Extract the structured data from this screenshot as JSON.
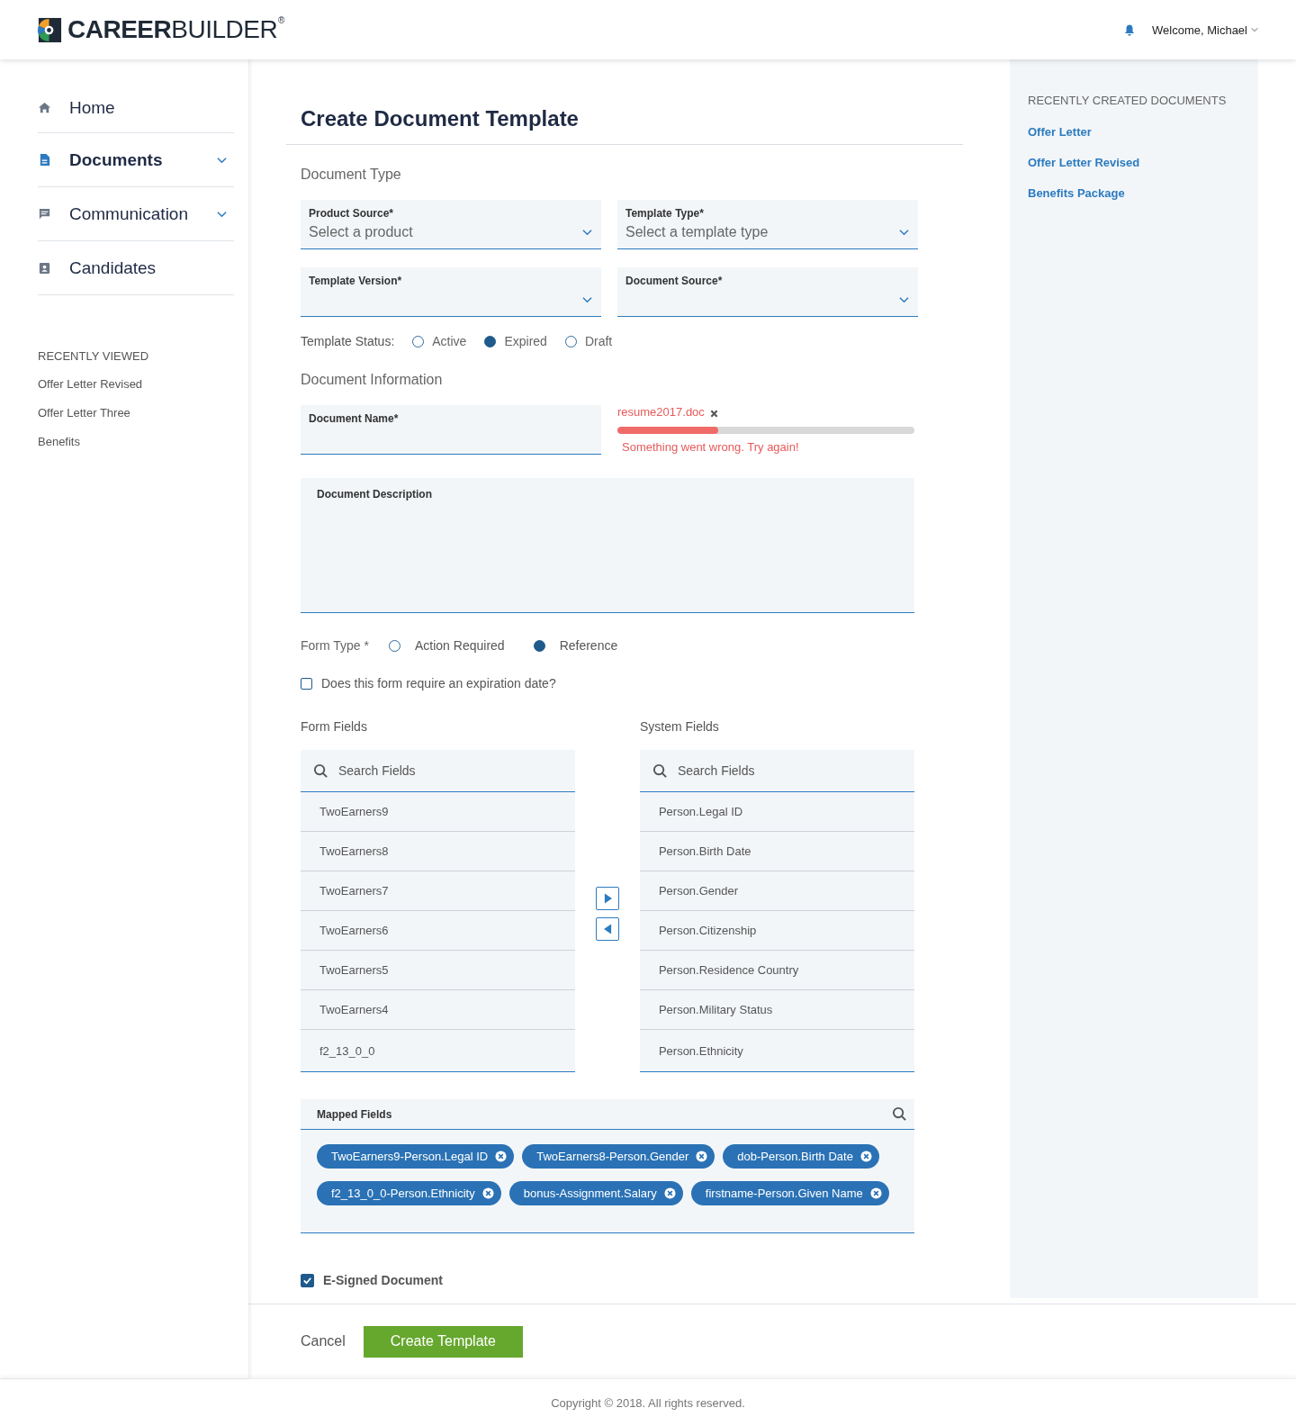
{
  "header": {
    "logo": {
      "bold": "CAREER",
      "light": "BUILDER",
      "mark": "®"
    },
    "welcome": "Welcome, Michael"
  },
  "sidebar": {
    "nav": [
      {
        "label": "Home",
        "kind": "home",
        "expandable": false,
        "selected": false
      },
      {
        "label": "Documents",
        "kind": "document",
        "expandable": true,
        "selected": true
      },
      {
        "label": "Communication",
        "kind": "chat",
        "expandable": true,
        "selected": false
      },
      {
        "label": "Candidates",
        "kind": "badge",
        "expandable": false,
        "selected": false
      }
    ],
    "recent_title": "RECENTLY VIEWED",
    "recent": [
      "Offer Letter Revised",
      "Offer Letter Three",
      "Benefits"
    ]
  },
  "page_title": "Create Document Template",
  "document_type": {
    "title": "Document Type",
    "selects": [
      {
        "label": "Product Source*",
        "placeholder": "Select a product"
      },
      {
        "label": "Template Type*",
        "placeholder": "Select a template type"
      },
      {
        "label": "Template Version*"
      },
      {
        "label": "Document Source*"
      }
    ]
  },
  "template_status": {
    "label": "Template Status:",
    "options": [
      {
        "label": "Active",
        "selected": false
      },
      {
        "label": "Expired",
        "selected": true
      },
      {
        "label": "Draft",
        "selected": false
      }
    ]
  },
  "document_information": {
    "title": "Document Information",
    "name_label": "Document Name*",
    "upload": {
      "filename": "resume2017.doc",
      "level": 0.34,
      "error": "Something went wrong. Try again!"
    },
    "description_label": "Document Description"
  },
  "form_type": {
    "label": "Form Type *",
    "options": [
      {
        "label": "Action Required",
        "selected": false
      },
      {
        "label": "Reference",
        "selected": true
      }
    ]
  },
  "expiration": {
    "label": "Does this form require an expiration date?",
    "checked": false
  },
  "form_fields": {
    "title": "Form Fields",
    "placeholder": "Search Fields",
    "items": [
      "TwoEarners9",
      "TwoEarners8",
      "TwoEarners7",
      "TwoEarners6",
      "TwoEarners5",
      "TwoEarners4",
      "f2_13_0_0"
    ]
  },
  "system_fields": {
    "title": "System Fields",
    "placeholder": "Search Fields",
    "items": [
      "Person.Legal ID",
      "Person.Birth Date",
      "Person.Gender",
      "Person.Citizenship",
      "Person.Residence Country",
      "Person.Military Status",
      "Person.Ethnicity"
    ]
  },
  "mapped_fields": {
    "title": "Mapped Fields",
    "tags": [
      "TwoEarners9-Person.Legal ID",
      "TwoEarners8-Person.Gender",
      "dob-Person.Birth Date",
      "f2_13_0_0-Person.Ethnicity",
      "bonus-Assignment.Salary",
      "firstname-Person.Given Name"
    ]
  },
  "esigned": {
    "label": "E-Signed Document",
    "checked": true
  },
  "actions": {
    "cancel": "Cancel",
    "submit": "Create Template"
  },
  "recently_created": {
    "title": "RECENTLY CREATED DOCUMENTS",
    "links": [
      "Offer Letter",
      "Offer Letter Revised",
      "Benefits Package"
    ]
  },
  "footer": "Copyright © 2018. All rights reserved."
}
